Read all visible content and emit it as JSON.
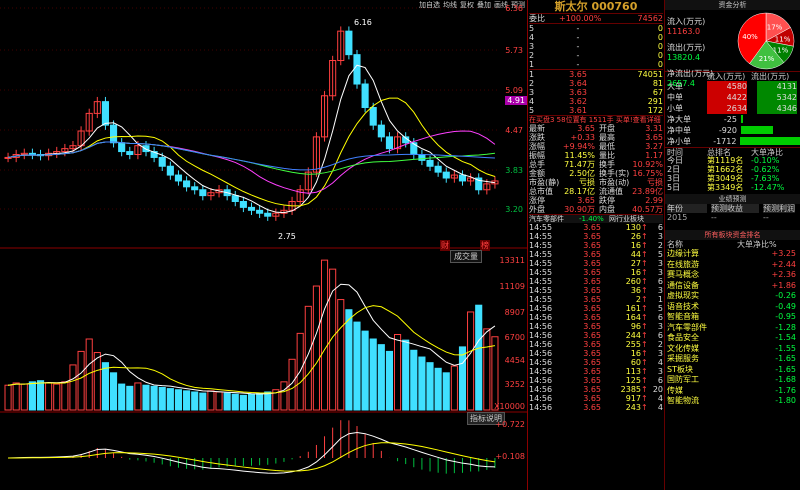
{
  "toolbar": [
    "加自选",
    "均线",
    "复权",
    "叠加",
    "画线",
    "预测"
  ],
  "chart": {
    "price_ticks": [
      "6.36",
      "5.73",
      "5.09",
      "4.47",
      "3.83",
      "3.20"
    ],
    "cur_price": "4.91",
    "high_mark": "6.16",
    "low_mark": "2.75",
    "vol_label": "成交量",
    "vol_ticks": [
      "13311",
      "11109",
      "8907",
      "6700",
      "4454",
      "3252",
      "X10000"
    ],
    "macd_ticks": [
      "+0.722",
      "+0.108"
    ],
    "ind_btn": "指标说明",
    "tabs": [
      "财",
      "榜"
    ]
  },
  "chart_data": {
    "type": "candlestick",
    "note": "daily candles",
    "price_range": [
      2.7,
      6.36
    ],
    "closes": [
      3.85,
      3.9,
      3.92,
      3.9,
      3.88,
      3.92,
      3.95,
      4.0,
      4.05,
      4.3,
      4.6,
      4.8,
      4.4,
      4.1,
      3.95,
      3.9,
      4.05,
      3.95,
      3.85,
      3.7,
      3.55,
      3.45,
      3.35,
      3.3,
      3.2,
      3.25,
      3.3,
      3.2,
      3.1,
      3.0,
      2.95,
      2.9,
      2.85,
      2.9,
      2.95,
      3.1,
      3.3,
      3.6,
      4.2,
      4.9,
      5.5,
      6.0,
      5.6,
      5.1,
      4.7,
      4.4,
      4.2,
      4.0,
      4.2,
      4.1,
      3.9,
      3.8,
      3.7,
      3.6,
      3.5,
      3.55,
      3.45,
      3.5,
      3.3,
      3.4,
      3.45
    ],
    "volumes": [
      2200,
      2400,
      2300,
      2500,
      2600,
      2400,
      2300,
      2500,
      4000,
      5200,
      6300,
      5100,
      4200,
      3300,
      2300,
      2100,
      2400,
      2200,
      2100,
      2000,
      1900,
      1800,
      1700,
      1600,
      1500,
      1700,
      1600,
      1500,
      1400,
      1300,
      1400,
      1500,
      1600,
      1800,
      2500,
      4500,
      6800,
      9200,
      11000,
      13300,
      12500,
      9800,
      8900,
      7800,
      7000,
      6300,
      5800,
      5200,
      6700,
      6200,
      5300,
      4700,
      4200,
      3700,
      3300,
      3900,
      5600,
      8700,
      9300,
      7200,
      6500
    ]
  },
  "quote": {
    "title": "斯太尔 000760",
    "weibi_l": "委比",
    "weibi": "+100.00%",
    "weicha": "74562",
    "sell": [
      [
        "5",
        "-",
        "0"
      ],
      [
        "4",
        "-",
        "0"
      ],
      [
        "3",
        "-",
        "0"
      ],
      [
        "2",
        "-",
        "0"
      ],
      [
        "1",
        "-",
        "0"
      ]
    ],
    "buy": [
      [
        "1",
        "3.65",
        "74051"
      ],
      [
        "2",
        "3.64",
        "81"
      ],
      [
        "3",
        "3.63",
        "67"
      ],
      [
        "4",
        "3.62",
        "291"
      ],
      [
        "5",
        "3.61",
        "172"
      ]
    ],
    "buy_note": "在买盘3 58位置有 1511手 买单!查看详细",
    "stats": [
      [
        "最新",
        "3.65",
        "开盘",
        "3.31"
      ],
      [
        "涨跌",
        "+0.33",
        "最高",
        "3.65"
      ],
      [
        "涨幅",
        "+9.94%",
        "最低",
        "3.27"
      ],
      [
        "振幅",
        "11.45%",
        "量比",
        "1.17"
      ],
      [
        "总手",
        "71.47万",
        "换手",
        "10.92%"
      ],
      [
        "金额",
        "2.50亿",
        "换手(实)",
        "16.75%"
      ],
      [
        "市盈(静)",
        "亏损",
        "市盈(动)",
        "亏损"
      ],
      [
        "总市值",
        "28.17亿",
        "流通值",
        "23.89亿"
      ],
      [
        "涨停",
        "3.65",
        "跌停",
        "2.99"
      ],
      [
        "外盘",
        "30.90万",
        "内盘",
        "40.57万"
      ]
    ],
    "tabs": [
      "汽车零部件",
      "-1.40%",
      "网行业板块"
    ],
    "ticks": [
      [
        "14:55",
        "3.65",
        "130",
        "6"
      ],
      [
        "14:55",
        "3.65",
        "26",
        "3"
      ],
      [
        "14:55",
        "3.65",
        "16",
        "2"
      ],
      [
        "14:55",
        "3.65",
        "44",
        "5"
      ],
      [
        "14:55",
        "3.65",
        "27",
        "3"
      ],
      [
        "14:55",
        "3.65",
        "16",
        "3"
      ],
      [
        "14:55",
        "3.65",
        "260",
        "6"
      ],
      [
        "14:55",
        "3.65",
        "36",
        "3"
      ],
      [
        "14:55",
        "3.65",
        "2",
        "1"
      ],
      [
        "14:56",
        "3.65",
        "161",
        "5"
      ],
      [
        "14:56",
        "3.65",
        "164",
        "6"
      ],
      [
        "14:56",
        "3.65",
        "96",
        "3"
      ],
      [
        "14:56",
        "3.65",
        "244",
        "6"
      ],
      [
        "14:56",
        "3.65",
        "255",
        "2"
      ],
      [
        "14:56",
        "3.65",
        "16",
        "3"
      ],
      [
        "14:56",
        "3.65",
        "60",
        "4"
      ],
      [
        "14:56",
        "3.65",
        "113",
        "3"
      ],
      [
        "14:56",
        "3.65",
        "125",
        "6"
      ],
      [
        "14:56",
        "3.65",
        "2385",
        "20"
      ],
      [
        "14:56",
        "3.65",
        "917",
        "4"
      ],
      [
        "14:56",
        "3.65",
        "243",
        "4"
      ]
    ]
  },
  "right": {
    "title": "资金分析",
    "pie": [
      {
        "label": "17%",
        "value": 17,
        "color": "#ff5050"
      },
      {
        "label": "11%",
        "value": 11,
        "color": "#c00000"
      },
      {
        "label": "11%",
        "value": 11,
        "color": "#008000"
      },
      {
        "label": "21%",
        "value": 21,
        "color": "#40c040"
      },
      {
        "label": "40%",
        "value": 40,
        "color": "#ff0000"
      }
    ],
    "flow": [
      [
        "流入(万元)",
        "11163.0"
      ],
      [
        "流出(万元)",
        "13820.4"
      ],
      [
        "净流出(万元)",
        "2657.4"
      ]
    ],
    "flow_hdr": [
      "流入(万元)",
      "流出(万元)"
    ],
    "big": [
      [
        "大单",
        "4580",
        "4131"
      ],
      [
        "中单",
        "4422",
        "5342"
      ],
      [
        "小单",
        "2634",
        "4346"
      ]
    ],
    "net": [
      [
        "净大单",
        "-25"
      ],
      [
        "净中单",
        "-920"
      ],
      [
        "净小单",
        "-1712"
      ]
    ],
    "rank_hdr": [
      "时间",
      "总排名",
      "大单净比"
    ],
    "rank": [
      [
        "今日",
        "第1119名",
        "-0.10%"
      ],
      [
        "2日",
        "第1662名",
        "-0.62%"
      ],
      [
        "3日",
        "第3049名",
        "-7.63%"
      ],
      [
        "5日",
        "第3349名",
        "-12.47%"
      ]
    ],
    "forecast_title": "业绩预测",
    "forecast_hdr": [
      "年份",
      "预测收益",
      "预测利润"
    ],
    "forecast_rows": [
      [
        "2015",
        "--",
        "--"
      ]
    ],
    "sector_title": "所有板块资金排名",
    "sector_hdr": [
      "名称",
      "大单净比%"
    ],
    "sectors": [
      [
        "边缘计算",
        "+3.25"
      ],
      [
        "在线旅游",
        "+2.44"
      ],
      [
        "赛马概念",
        "+2.36"
      ],
      [
        "通信设备",
        "+1.86"
      ],
      [
        "虚拟现实",
        "-0.26"
      ],
      [
        "语音技术",
        "-0.49"
      ],
      [
        "智能音箱",
        "-0.95"
      ],
      [
        "汽车零部件",
        "-1.28"
      ],
      [
        "食品安全",
        "-1.54"
      ],
      [
        "文化传媒",
        "-1.55"
      ],
      [
        "采掘服务",
        "-1.65"
      ],
      [
        "ST板块",
        "-1.65"
      ],
      [
        "国防军工",
        "-1.68"
      ],
      [
        "传媒",
        "-1.76"
      ],
      [
        "智能物流",
        "-1.80"
      ]
    ]
  }
}
